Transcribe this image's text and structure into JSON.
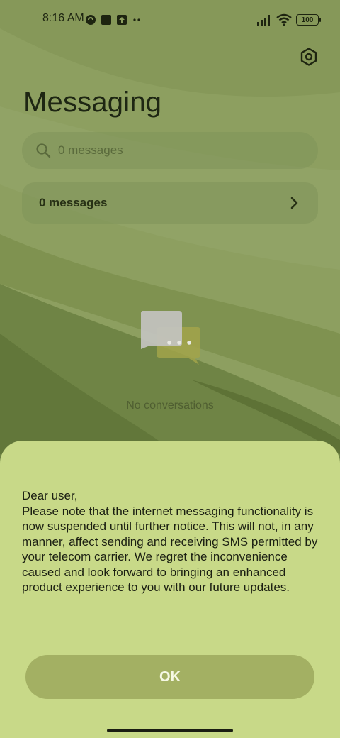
{
  "status_bar": {
    "time": "8:16 AM",
    "battery": "100",
    "icons": [
      "vpn-icon",
      "square-notification-icon",
      "upload-notification-icon",
      "more-dots-icon",
      "signal-icon",
      "wifi-icon",
      "battery-icon"
    ]
  },
  "header": {
    "title": "Messaging",
    "settings_icon": "settings-icon"
  },
  "search": {
    "placeholder": "0 messages"
  },
  "summary_card": {
    "label": "0 messages"
  },
  "empty_state": {
    "text": "No conversations",
    "icon": "chat-bubbles-icon"
  },
  "dialog": {
    "message": "Dear user,\nPlease note that the internet messaging functionality is now suspended until further notice. This will not, in any manner, affect sending and receiving SMS permitted by your telecom carrier. We regret the inconvenience caused and look forward to bringing an enhanced product experience to you with our future updates.",
    "ok_label": "OK"
  },
  "colors": {
    "background": "#8a9c5c",
    "sheet": "#c8d988",
    "button": "#a3b063"
  }
}
